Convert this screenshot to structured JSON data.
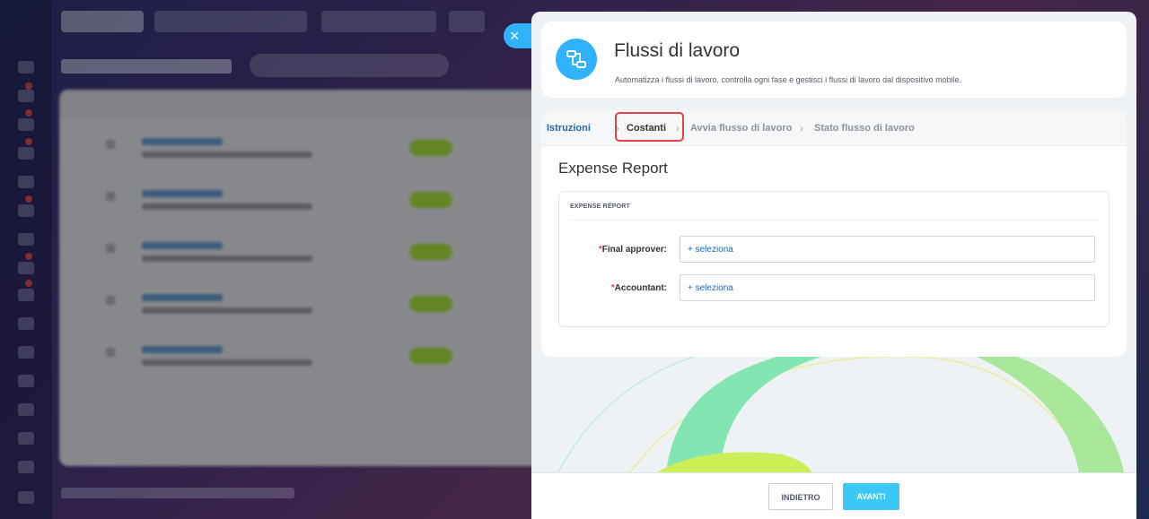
{
  "slider": {
    "title": "Flussi di lavoro",
    "subtitle": "Automatizza i flussi di lavoro, controlla ogni fase e gestisci i flussi di lavoro dal dispositivo mobile.",
    "close_icon": "×"
  },
  "steps": [
    {
      "label": "Istruzioni",
      "state": "done"
    },
    {
      "label": "Costanti",
      "state": "active"
    },
    {
      "label": "Avvia flusso di lavoro",
      "state": "todo"
    },
    {
      "label": "Stato flusso di lavoro",
      "state": "todo"
    }
  ],
  "step_separator": "›",
  "form": {
    "title": "Expense Report",
    "section": "EXPENSE REPORT",
    "fields": [
      {
        "required_mark": "*",
        "label": "Final approver:",
        "action": "+ seleziona"
      },
      {
        "required_mark": "*",
        "label": "Accountant:",
        "action": "+ seleziona"
      }
    ]
  },
  "footer": {
    "back_label": "INDIETRO",
    "next_label": "AVANTI"
  },
  "colors": {
    "accent": "#2fb3ff",
    "primary_button": "#3bc8f5",
    "link": "#2067b0",
    "highlight": "#e9414b"
  }
}
